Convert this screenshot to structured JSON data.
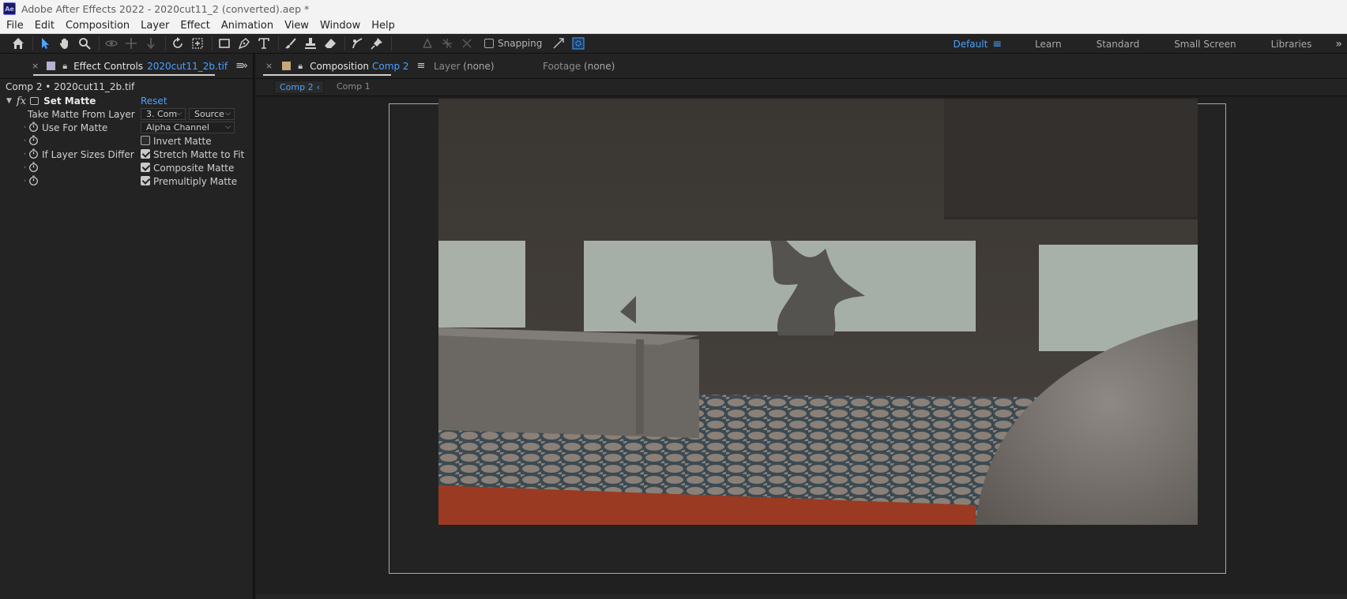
{
  "app": {
    "title": "Adobe After Effects 2022 - 2020cut11_2 (converted).aep *",
    "logo_text": "Ae"
  },
  "menu": {
    "items": [
      "File",
      "Edit",
      "Composition",
      "Layer",
      "Effect",
      "Animation",
      "View",
      "Window",
      "Help"
    ]
  },
  "toolbar": {
    "snapping_label": "Snapping",
    "snapping_checked": false
  },
  "workspaces": {
    "items": [
      "Default",
      "Learn",
      "Standard",
      "Small Screen",
      "Libraries"
    ],
    "active": "Default",
    "more": "»"
  },
  "effect_controls": {
    "tab_label": "Effect Controls",
    "tab_target": "2020cut11_2b.tif",
    "layer_path": "Comp 2 • 2020cut11_2b.tif",
    "effect_name": "Set Matte",
    "reset_label": "Reset",
    "properties": {
      "take_matte_label": "Take Matte From Layer",
      "take_matte_value": "3. Com",
      "take_matte_source": "Source",
      "use_for_matte_label": "Use For Matte",
      "use_for_matte_value": "Alpha Channel",
      "invert_matte_label": "Invert Matte",
      "invert_matte_checked": false,
      "layer_sizes_label": "If Layer Sizes Differ",
      "stretch_label": "Stretch Matte to Fit",
      "stretch_checked": true,
      "composite_label": "Composite Matte",
      "composite_checked": true,
      "premultiply_label": "Premultiply Matte",
      "premultiply_checked": true
    }
  },
  "composition": {
    "tab_label": "Composition",
    "tab_target": "Comp 2",
    "layer_label": "Layer",
    "layer_value": "(none)",
    "footage_label": "Footage",
    "footage_value": "(none)",
    "subtabs": [
      "Comp 2",
      "Comp 1"
    ],
    "active_subtab": "Comp 2"
  },
  "colors": {
    "accent": "#4aa1ff",
    "panel_bg": "#232323",
    "viewer_bg": "#202020"
  }
}
